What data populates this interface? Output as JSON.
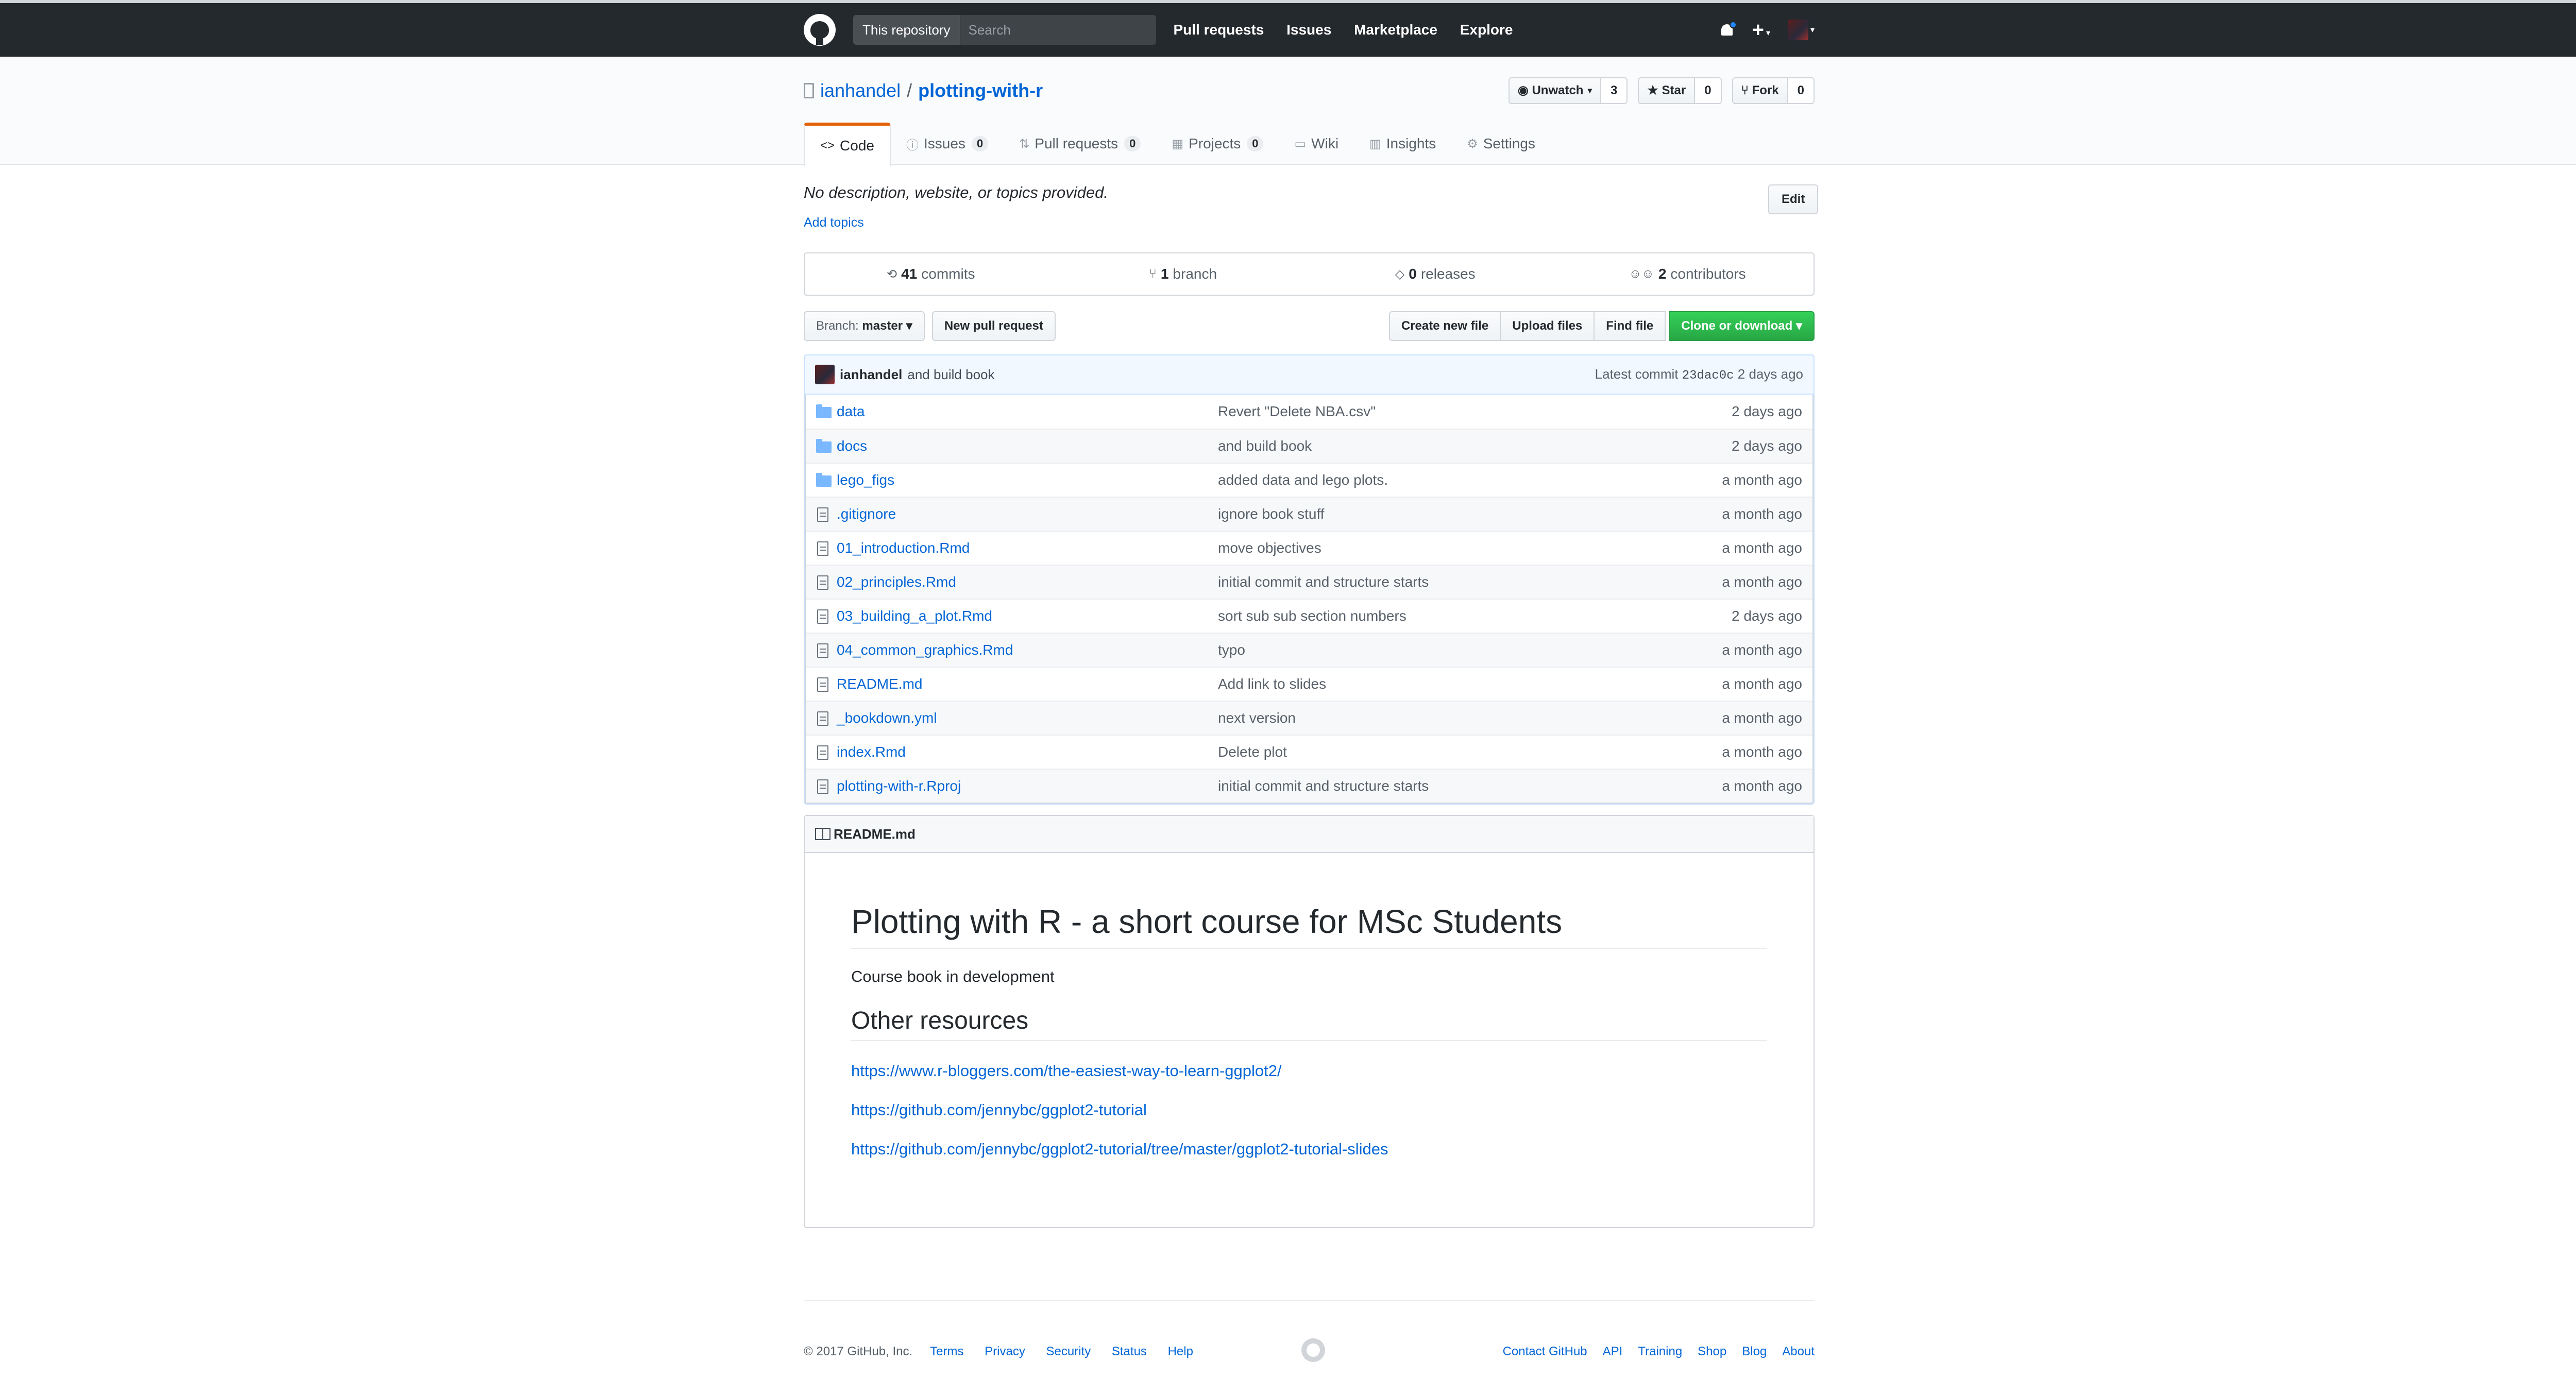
{
  "header": {
    "search_scope": "This repository",
    "search_placeholder": "Search",
    "nav": [
      "Pull requests",
      "Issues",
      "Marketplace",
      "Explore"
    ],
    "plus": "+"
  },
  "repo": {
    "owner": "ianhandel",
    "separator": "/",
    "name": "plotting-with-r",
    "actions": [
      {
        "label": "Unwatch",
        "count": "3",
        "icon": "eye-icon"
      },
      {
        "label": "Star",
        "count": "0",
        "icon": "star-icon"
      },
      {
        "label": "Fork",
        "count": "0",
        "icon": "fork-icon"
      }
    ],
    "tabs": [
      {
        "label": "Code",
        "icon": "code-icon",
        "counter": ""
      },
      {
        "label": "Issues",
        "icon": "issue-icon",
        "counter": "0"
      },
      {
        "label": "Pull requests",
        "icon": "pr-icon",
        "counter": "0"
      },
      {
        "label": "Projects",
        "icon": "project-icon",
        "counter": "0"
      },
      {
        "label": "Wiki",
        "icon": "book-icon",
        "counter": ""
      },
      {
        "label": "Insights",
        "icon": "graph-icon",
        "counter": ""
      },
      {
        "label": "Settings",
        "icon": "gear-icon",
        "counter": ""
      }
    ]
  },
  "description": {
    "text": "No description, website, or topics provided.",
    "add_topics": "Add topics",
    "edit": "Edit"
  },
  "summary": [
    {
      "count": "41",
      "label": "commits",
      "icon": "history-icon"
    },
    {
      "count": "1",
      "label": "branch",
      "icon": "branch-icon"
    },
    {
      "count": "0",
      "label": "releases",
      "icon": "tag-icon"
    },
    {
      "count": "2",
      "label": "contributors",
      "icon": "people-icon"
    }
  ],
  "filenav": {
    "branch_prefix": "Branch:",
    "branch": "master",
    "new_pr": "New pull request",
    "create_file": "Create new file",
    "upload_files": "Upload files",
    "find_file": "Find file",
    "clone": "Clone or download"
  },
  "commit": {
    "author": "ianhandel",
    "message": "and build book",
    "latest_label": "Latest commit",
    "sha": "23dac0c",
    "age": "2 days ago"
  },
  "files": [
    {
      "type": "dir",
      "name": "data",
      "message": "Revert \"Delete NBA.csv\"",
      "age": "2 days ago"
    },
    {
      "type": "dir",
      "name": "docs",
      "message": "and build book",
      "age": "2 days ago"
    },
    {
      "type": "dir",
      "name": "lego_figs",
      "message": "added data and lego plots.",
      "age": "a month ago"
    },
    {
      "type": "file",
      "name": ".gitignore",
      "message": "ignore book stuff",
      "age": "a month ago"
    },
    {
      "type": "file",
      "name": "01_introduction.Rmd",
      "message": "move objectives",
      "age": "a month ago"
    },
    {
      "type": "file",
      "name": "02_principles.Rmd",
      "message": "initial commit and structure starts",
      "age": "a month ago"
    },
    {
      "type": "file",
      "name": "03_building_a_plot.Rmd",
      "message": "sort sub sub section numbers",
      "age": "2 days ago"
    },
    {
      "type": "file",
      "name": "04_common_graphics.Rmd",
      "message": "typo",
      "age": "a month ago"
    },
    {
      "type": "file",
      "name": "README.md",
      "message": "Add link to slides",
      "age": "a month ago"
    },
    {
      "type": "file",
      "name": "_bookdown.yml",
      "message": "next version",
      "age": "a month ago"
    },
    {
      "type": "file",
      "name": "index.Rmd",
      "message": "Delete plot",
      "age": "a month ago"
    },
    {
      "type": "file",
      "name": "plotting-with-r.Rproj",
      "message": "initial commit and structure starts",
      "age": "a month ago"
    }
  ],
  "readme": {
    "filename": "README.md",
    "title": "Plotting with R - a short course for MSc Students",
    "intro": "Course book in development",
    "subtitle": "Other resources",
    "links": [
      "https://www.r-bloggers.com/the-easiest-way-to-learn-ggplot2/",
      "https://github.com/jennybc/ggplot2-tutorial",
      "https://github.com/jennybc/ggplot2-tutorial/tree/master/ggplot2-tutorial-slides"
    ]
  },
  "footer": {
    "copyright": "© 2017 GitHub, Inc.",
    "left_links": [
      "Terms",
      "Privacy",
      "Security",
      "Status",
      "Help"
    ],
    "right_links": [
      "Contact GitHub",
      "API",
      "Training",
      "Shop",
      "Blog",
      "About"
    ]
  },
  "colors": {
    "header_bg": "#24292e",
    "link": "#0366d6",
    "primary_button": "#28a745",
    "selected_tab_accent": "#e36209"
  }
}
